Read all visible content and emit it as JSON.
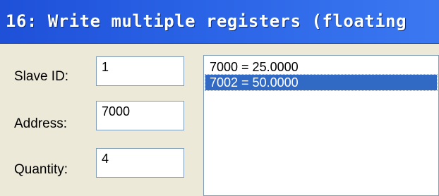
{
  "window": {
    "title": "16: Write multiple registers (floating"
  },
  "form": {
    "slave_id": {
      "label": "Slave ID:",
      "value": "1"
    },
    "address": {
      "label": "Address:",
      "value": "7000"
    },
    "quantity": {
      "label": "Quantity:",
      "value": "4"
    }
  },
  "register_list": {
    "items": [
      {
        "text": "7000 = 25.0000",
        "selected": false
      },
      {
        "text": "7002 = 50.0000",
        "selected": true
      }
    ]
  },
  "colors": {
    "title_bar": "#2a63e6",
    "selection": "#316ac5",
    "window_bg": "#ece9d8"
  }
}
